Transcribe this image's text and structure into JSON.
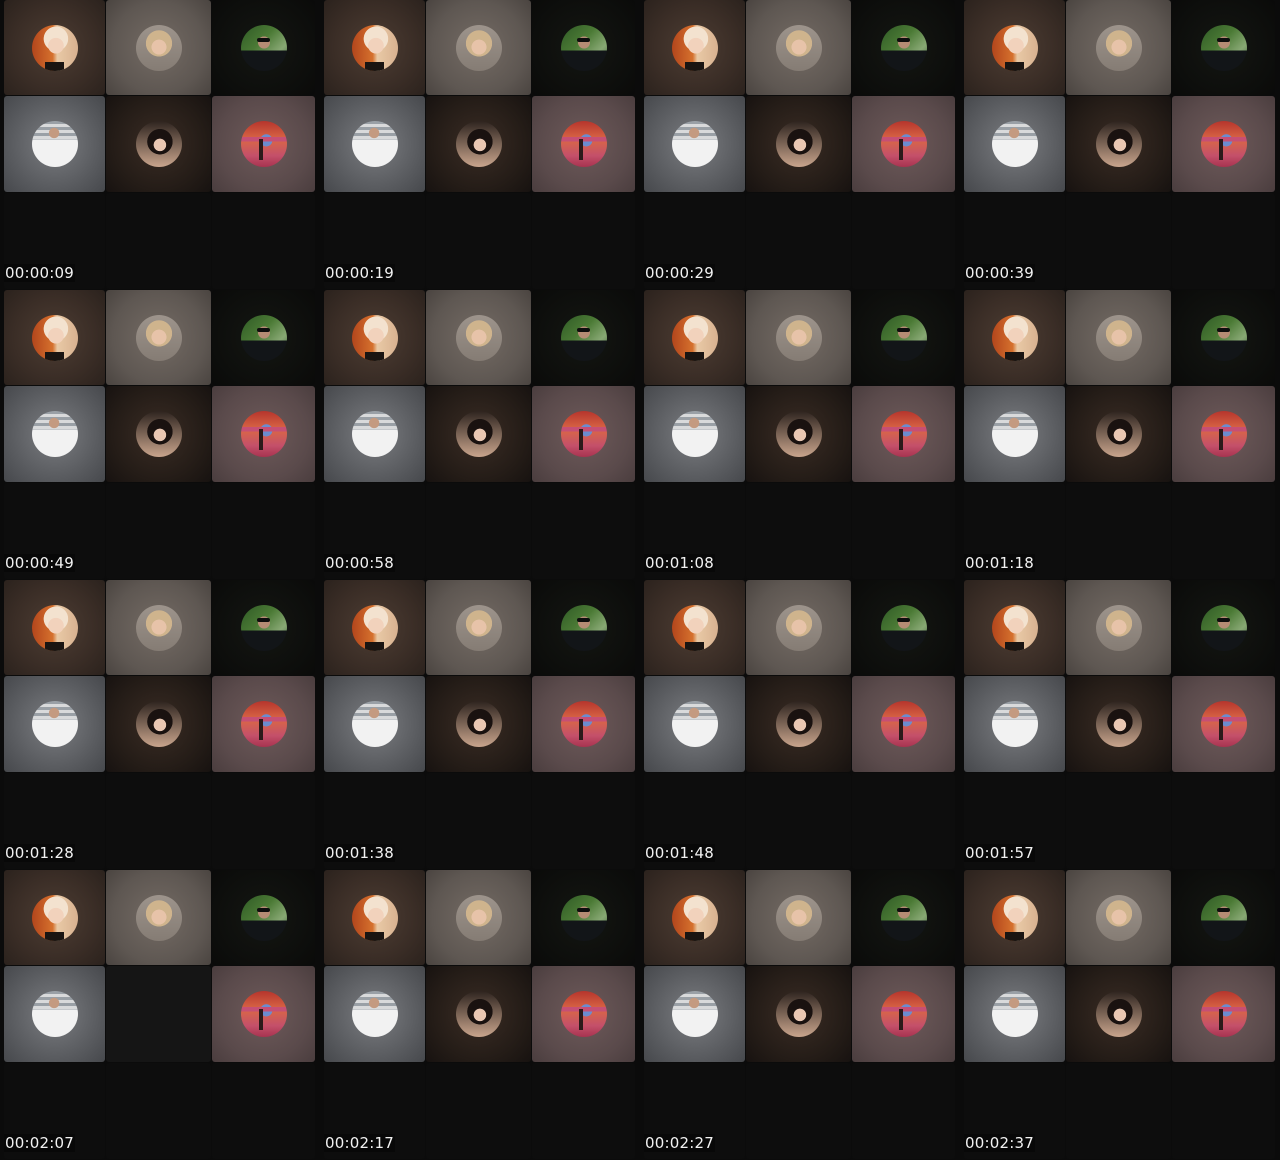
{
  "sheet": {
    "frames": [
      {
        "timestamp": "00:00:09"
      },
      {
        "timestamp": "00:00:19"
      },
      {
        "timestamp": "00:00:29"
      },
      {
        "timestamp": "00:00:39"
      },
      {
        "timestamp": "00:00:49"
      },
      {
        "timestamp": "00:00:58"
      },
      {
        "timestamp": "00:01:08"
      },
      {
        "timestamp": "00:01:18"
      },
      {
        "timestamp": "00:01:28"
      },
      {
        "timestamp": "00:01:38"
      },
      {
        "timestamp": "00:01:48"
      },
      {
        "timestamp": "00:01:57"
      },
      {
        "timestamp": "00:02:07"
      },
      {
        "timestamp": "00:02:17"
      },
      {
        "timestamp": "00:02:27"
      },
      {
        "timestamp": "00:02:37"
      }
    ]
  }
}
